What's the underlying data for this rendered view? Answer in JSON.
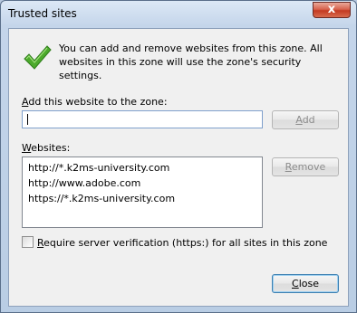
{
  "window": {
    "title": "Trusted sites",
    "close_glyph": "x"
  },
  "info": {
    "icon": "checkmark-icon",
    "message": "You can add and remove websites from this zone. All websites in this zone will use the zone's security settings."
  },
  "add": {
    "label_prefix": "A",
    "label_rest": "dd this website to the zone:",
    "input_value": "",
    "button_prefix": "A",
    "button_rest": "dd"
  },
  "websites": {
    "label_prefix": "W",
    "label_rest": "ebsites:",
    "items": [
      "http://*.k2ms-university.com",
      "http://www.adobe.com",
      "https://*.k2ms-university.com"
    ],
    "remove_prefix": "R",
    "remove_rest": "emove"
  },
  "verification": {
    "checked": false,
    "label_prefix": "R",
    "label_rest": "equire server verification (https:) for all sites in this zone"
  },
  "footer": {
    "close_prefix": "C",
    "close_rest": "lose"
  }
}
